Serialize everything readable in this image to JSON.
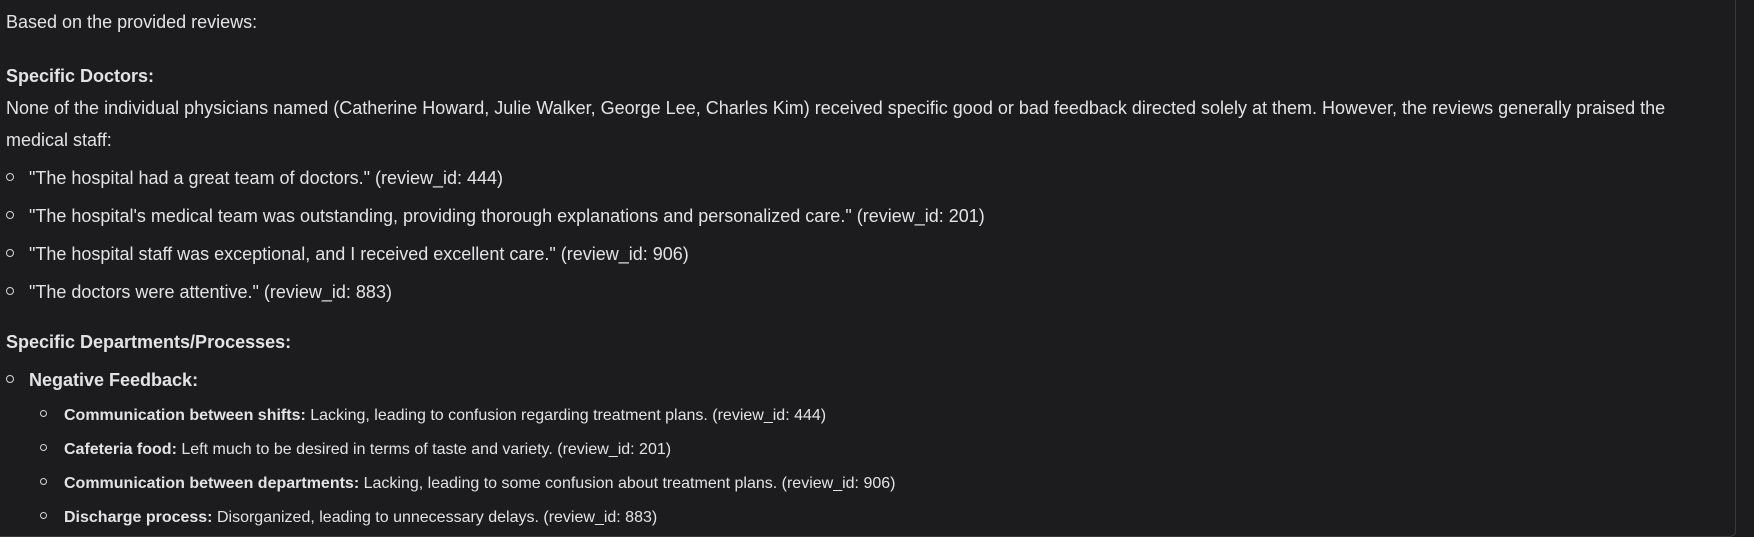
{
  "intro": "Based on the provided reviews:",
  "doctors": {
    "heading": "Specific Doctors:",
    "summary": "None of the individual physicians named (Catherine Howard, Julie Walker, George Lee, Charles Kim) received specific good or bad feedback directed solely at them. However, the reviews generally praised the medical staff:",
    "quotes": [
      "\"The hospital had a great team of doctors.\" (review_id: 444)",
      "\"The hospital's medical team was outstanding, providing thorough explanations and personalized care.\" (review_id: 201)",
      "\"The hospital staff was exceptional, and I received excellent care.\" (review_id: 906)",
      "\"The doctors were attentive.\" (review_id: 883)"
    ]
  },
  "departments": {
    "heading": "Specific Departments/Processes:",
    "negative_label": "Negative Feedback:",
    "items": [
      {
        "label": "Communication between shifts:",
        "text": " Lacking, leading to confusion regarding treatment plans. (review_id: 444)"
      },
      {
        "label": "Cafeteria food:",
        "text": " Left much to be desired in terms of taste and variety. (review_id: 201)"
      },
      {
        "label": "Communication between departments:",
        "text": " Lacking, leading to some confusion about treatment plans. (review_id: 906)"
      },
      {
        "label": "Discharge process:",
        "text": " Disorganized, leading to unnecessary delays. (review_id: 883)"
      }
    ]
  }
}
